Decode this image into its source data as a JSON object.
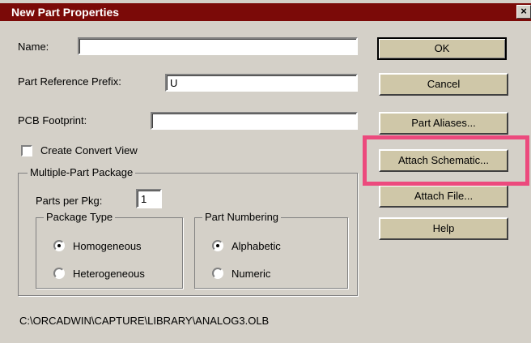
{
  "window": {
    "title": "New Part Properties",
    "close_label": "×"
  },
  "name": {
    "label": "Name:",
    "value": ""
  },
  "prefix": {
    "label": "Part Reference Prefix:",
    "value": "U"
  },
  "footprint": {
    "label": "PCB Footprint:",
    "value": ""
  },
  "convert_view": {
    "label": "Create Convert View",
    "checked": false
  },
  "multi_part": {
    "title": "Multiple-Part Package",
    "parts_label": "Parts per Pkg:",
    "parts_value": "1",
    "package_type": {
      "title": "Package Type",
      "options": [
        "Homogeneous",
        "Heterogeneous"
      ],
      "selected": "Homogeneous"
    },
    "numbering": {
      "title": "Part Numbering",
      "options": [
        "Alphabetic",
        "Numeric"
      ],
      "selected": "Alphabetic"
    }
  },
  "buttons": {
    "ok": "OK",
    "cancel": "Cancel",
    "aliases": "Part Aliases...",
    "schematic": "Attach Schematic...",
    "file": "Attach File...",
    "help": "Help"
  },
  "path": "C:\\ORCADWIN\\CAPTURE\\LIBRARY\\ANALOG3.OLB",
  "colors": {
    "titlebar": "#7b0a08",
    "highlight": "#ec4a7d",
    "dialog": "#d4d0c8"
  }
}
